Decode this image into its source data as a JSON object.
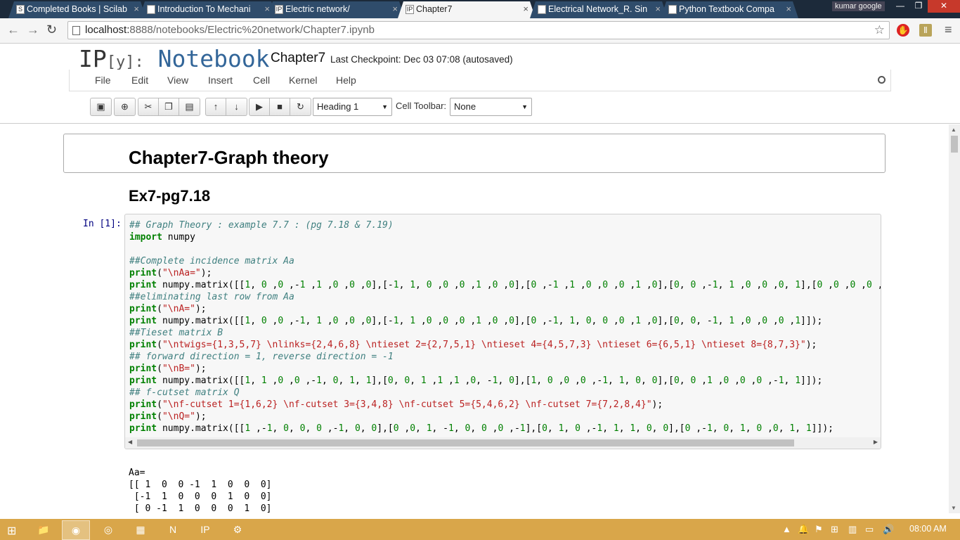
{
  "browser": {
    "tabs": [
      {
        "title": "Completed Books | Scilab",
        "icon": "S"
      },
      {
        "title": "Introduction To Mechani",
        "icon": ""
      },
      {
        "title": "Electric network/",
        "icon": "IP"
      },
      {
        "title": "Chapter7",
        "icon": "IP"
      },
      {
        "title": "Electrical Network_R. Sin",
        "icon": ""
      },
      {
        "title": "Python Textbook Compa",
        "icon": ""
      }
    ],
    "user": "kumar google",
    "url_host": "localhost:",
    "url_rest": "8888/notebooks/Electric%20network/Chapter7.ipynb"
  },
  "notebook": {
    "logo_ip": "IP",
    "logo_y": "[y]:",
    "logo_word": "Notebook",
    "title": "Chapter7",
    "checkpoint": "Last Checkpoint: Dec 03 07:08 (autosaved)",
    "menu": [
      "File",
      "Edit",
      "View",
      "Insert",
      "Cell",
      "Kernel",
      "Help"
    ],
    "cell_type": "Heading 1",
    "cell_toolbar_label": "Cell Toolbar:",
    "cell_toolbar_value": "None"
  },
  "cells": {
    "h1": "Chapter7-Graph theory",
    "h2": "Ex7-pg7.18",
    "prompt": "In [1]:",
    "output": "Aa=\n[[ 1  0  0 -1  1  0  0  0]\n [-1  1  0  0  0  1  0  0]\n [ 0 -1  1  0  0  0  1  0]"
  },
  "taskbar": {
    "clock": "08:00 AM"
  },
  "colors": {
    "tabstrip": "#1c2a3a",
    "taskbar": "#d9a64a",
    "logo_blue": "#336699",
    "comment": "#408080",
    "keyword": "#008000",
    "string": "#ba2121"
  }
}
